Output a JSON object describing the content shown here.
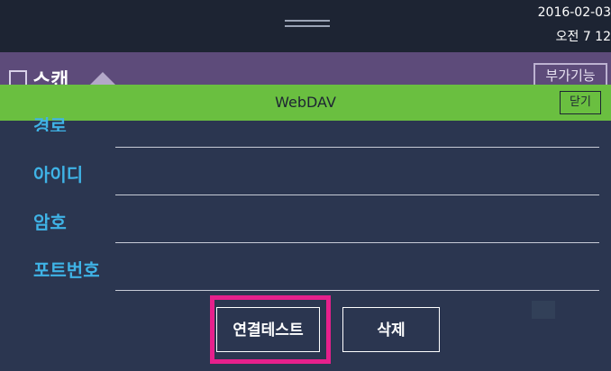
{
  "status_bar": {
    "date": "2016-02-03",
    "time": "오전 7 12"
  },
  "background_app": {
    "title": "스캔",
    "extra_button": "부가기능"
  },
  "dialog": {
    "title": "WebDAV",
    "close_label": "닫기",
    "fields": {
      "host_partial": "경로",
      "id_label": "아이디",
      "password_label": "암호",
      "port_label": "포트번호"
    },
    "test_button": "연결테스트",
    "delete_button": "삭제"
  },
  "colors": {
    "dialog_header": "#6abf40",
    "label": "#3fb3e6",
    "highlight": "#e6208c",
    "background": "#2b3650"
  }
}
